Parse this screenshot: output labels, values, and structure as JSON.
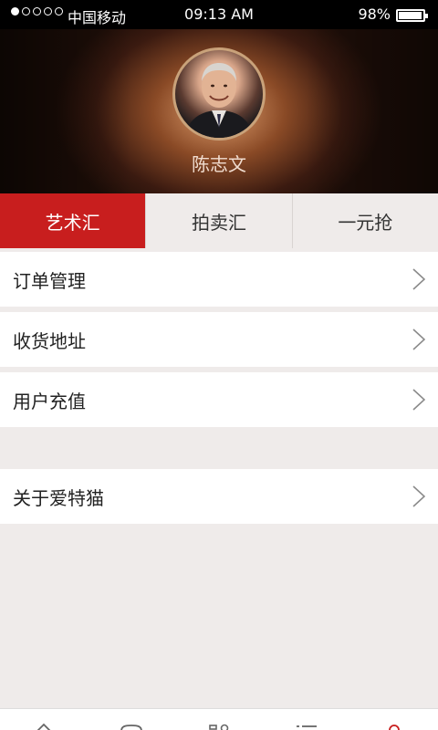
{
  "status_bar": {
    "carrier": "中国移动",
    "time": "09:13 AM",
    "battery": "98%",
    "battery_level": 0.98,
    "signal_bars_filled": 1,
    "signal_bars_total": 5
  },
  "profile": {
    "name": "陈志文",
    "avatar_icon": "person-avatar"
  },
  "tabs": [
    {
      "label": "艺术汇",
      "active": true
    },
    {
      "label": "拍卖汇",
      "active": false
    },
    {
      "label": "一元抢",
      "active": false
    }
  ],
  "menu": [
    {
      "label": "订单管理",
      "icon": "chevron-right-icon"
    },
    {
      "label": "收货地址",
      "icon": "chevron-right-icon"
    },
    {
      "label": "用户充值",
      "icon": "chevron-right-icon"
    },
    {
      "label": "关于爱特猫",
      "icon": "chevron-right-icon"
    }
  ],
  "bottom_nav": [
    {
      "icon": "home-icon",
      "active": false
    },
    {
      "icon": "chat-icon",
      "active": false
    },
    {
      "icon": "category-icon",
      "active": false
    },
    {
      "icon": "list-icon",
      "active": false
    },
    {
      "icon": "profile-icon",
      "active": true
    }
  ],
  "colors": {
    "accent": "#c81e1e",
    "background": "#efebea",
    "text": "#222222"
  }
}
